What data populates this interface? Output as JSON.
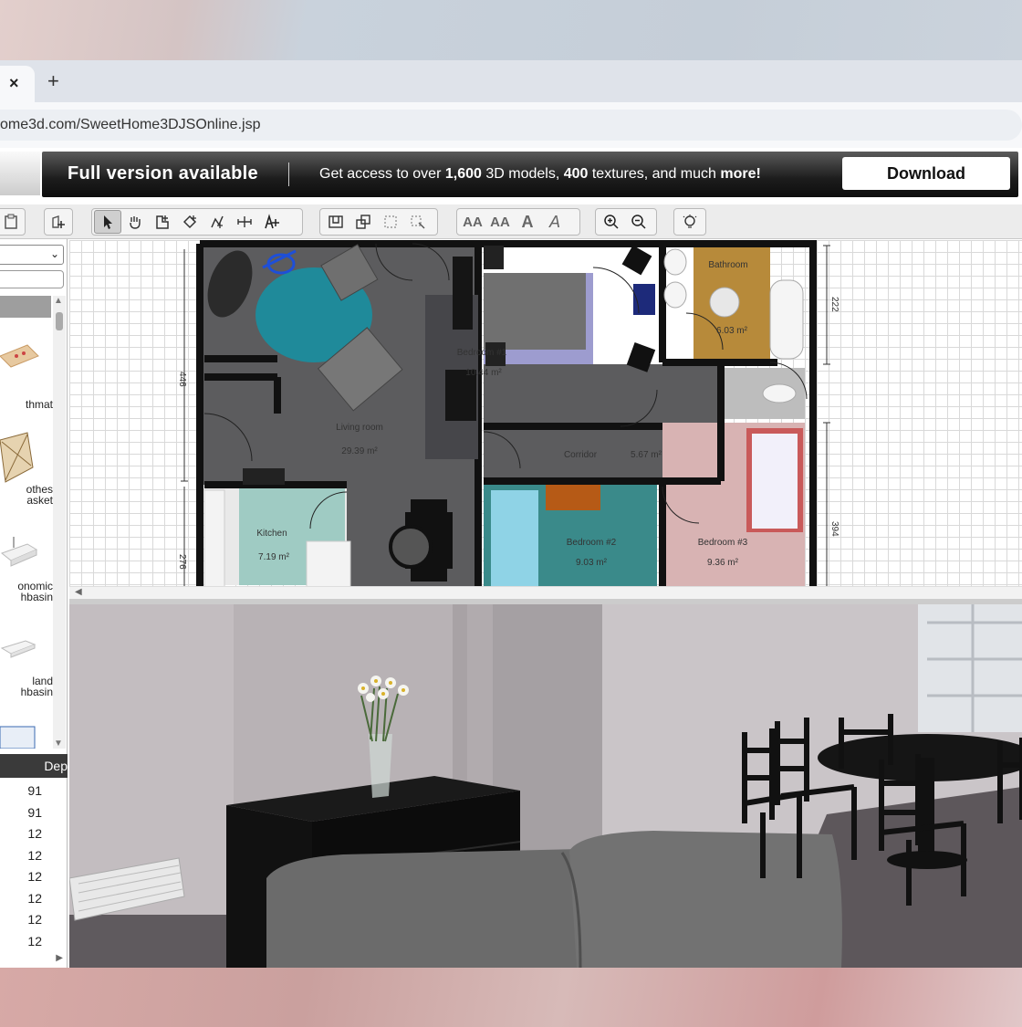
{
  "browser": {
    "tab_close": "×",
    "new_tab": "+",
    "url": "ome3d.com/SweetHome3DJSOnline.jsp"
  },
  "promo": {
    "title": "Full version available",
    "text_prefix": "Get access to over ",
    "models": "1,600",
    "text_mid1": " 3D models, ",
    "textures": "400",
    "text_mid2": " textures, and much ",
    "more": "more!",
    "download_label": "Download"
  },
  "catalog": {
    "items": [
      {
        "line1": "thmat",
        "line2": ""
      },
      {
        "line1": "othes",
        "line2": "asket"
      },
      {
        "line1": "onomic",
        "line2": "hbasin"
      },
      {
        "line1": "land",
        "line2": "hbasin"
      }
    ]
  },
  "furniture": {
    "header": "Dep",
    "rows": [
      "91",
      "91",
      "12",
      "12",
      "12",
      "12",
      "12",
      "12"
    ]
  },
  "plan": {
    "rooms": [
      {
        "name": "Living room",
        "area": "29.39 m²"
      },
      {
        "name": "Bedroom #1",
        "area": "10.44 m²"
      },
      {
        "name": "Bathroom",
        "area": "6.03 m²"
      },
      {
        "name": "Corridor",
        "area": "5.67 m²"
      },
      {
        "name": "Kitchen",
        "area": "7.19 m²"
      },
      {
        "name": "Bedroom #2",
        "area": "9.03 m²"
      },
      {
        "name": "Bedroom #3",
        "area": "9.36 m²"
      }
    ],
    "dimensions": [
      "446",
      "276",
      "222",
      "394"
    ]
  },
  "colors": {
    "living_floor": "#5c5c5e",
    "kitchen_floor": "#9fcbc3",
    "bathroom_floor": "#b78a3a",
    "bedroom1_floor": "#9d9ccf",
    "bedroom2_floor": "#3a8a8a",
    "bedroom3_floor": "#d8b3b3",
    "rug": "#1f8a9a"
  }
}
